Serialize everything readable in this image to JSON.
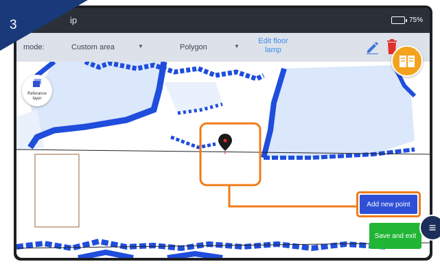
{
  "tutorial": {
    "step_number": "3"
  },
  "statusbar": {
    "title_fragment": "ip",
    "battery": "75%"
  },
  "toolbar": {
    "mode_label": "mode:",
    "mode_value": "Custom area",
    "shape_value": "Polygon",
    "edit_label_line1": "Edit floor",
    "edit_label_line2": "lamp",
    "pencil_icon": "pencil-icon",
    "trash_icon": "trash-icon"
  },
  "map": {
    "reference_layer_line1": "Referance",
    "reference_layer_line2": "layer"
  },
  "actions": {
    "add_point_label": "Add new point",
    "save_exit_label": "Save and exit",
    "fab_glyph": "≡"
  },
  "colors": {
    "accent_highlight": "#f07b18",
    "step_badge": "#19397a",
    "add_button": "#2f4fd6",
    "save_button": "#20b534",
    "map_obstacle": "#1f4ddc",
    "map_free": "#dbe7fb",
    "help_button": "#f3a31f"
  }
}
